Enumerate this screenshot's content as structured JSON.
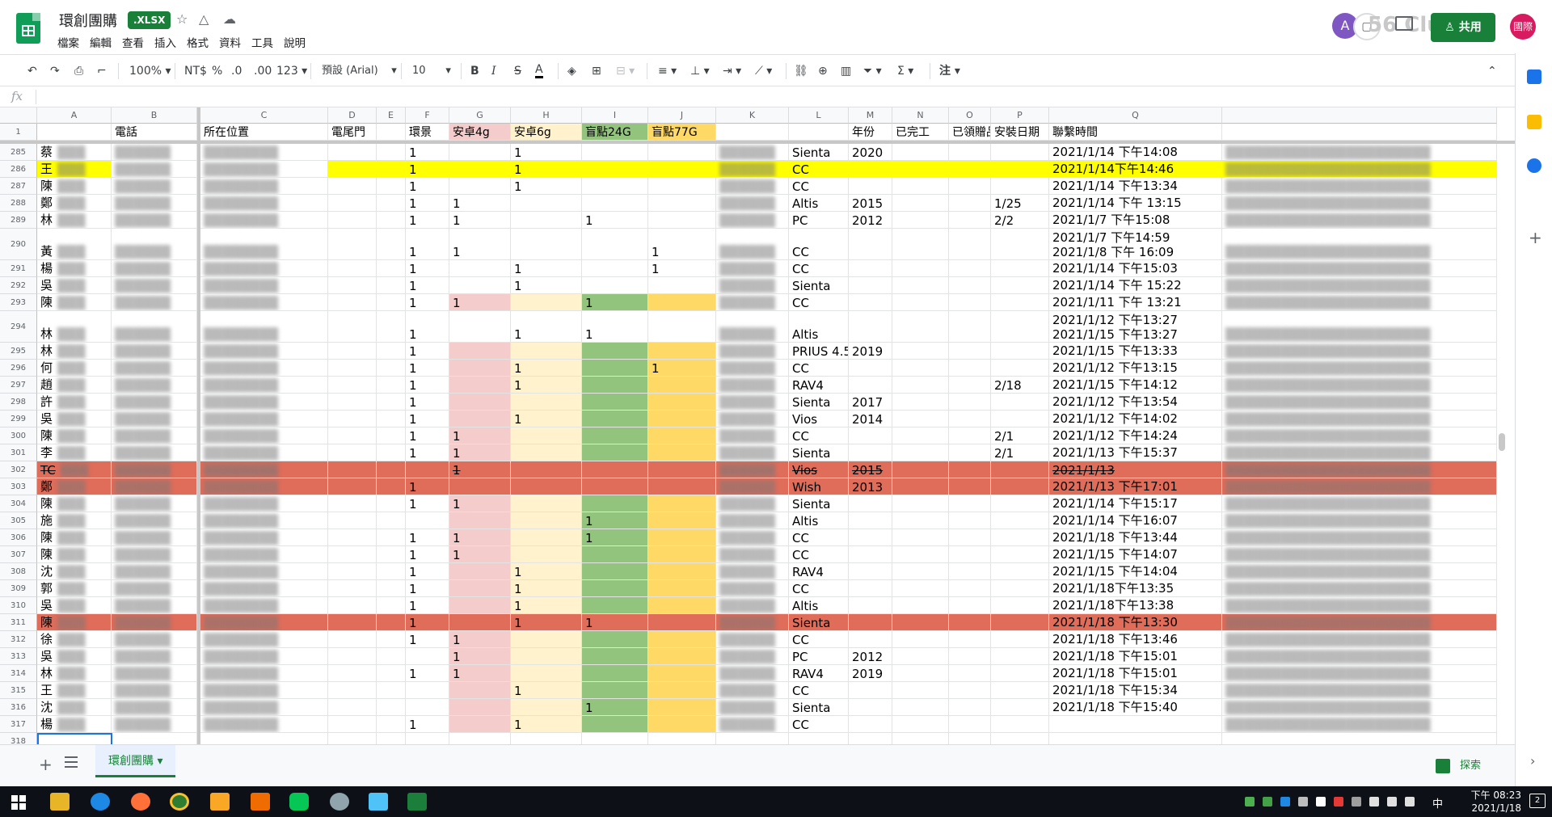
{
  "document": {
    "title": "環創團購",
    "badge": ".XLSX",
    "menu": [
      "檔案",
      "編輯",
      "查看",
      "插入",
      "格式",
      "資料",
      "工具",
      "說明"
    ],
    "share_label": "共用",
    "user_avatar_text": "國際",
    "collaborator_initial": "A",
    "watermark_text": "56 Clu"
  },
  "toolbar": {
    "zoom": "100%",
    "currency": "NT$",
    "percent": "%",
    "dec_decrease": ".0",
    "dec_increase": ".00",
    "format_more": "123",
    "font": "預設 (Arial)",
    "font_size": "10",
    "bold": "B",
    "italic": "I",
    "strike": "S",
    "text_color": "A",
    "sigma": "Σ",
    "note_btn": "注"
  },
  "formula_bar": {
    "fx": "fx"
  },
  "colors": {
    "yellow_row": "#ffff00",
    "red_row": "#e06c5a",
    "pink_col": "#f4cccc",
    "cream_col": "#fff2cc",
    "green_col": "#93c47d",
    "gold_col": "#ffd966",
    "brand_green": "#188038"
  },
  "grid": {
    "columns": [
      "A",
      "B",
      "C",
      "D",
      "E",
      "F",
      "G",
      "H",
      "I",
      "J",
      "K",
      "L",
      "M",
      "N",
      "O",
      "P",
      "Q"
    ],
    "header_row_number": "1",
    "header": [
      "",
      "電話",
      "所在位置",
      "電尾門",
      "",
      "環景",
      "安卓4g",
      "安卓6g",
      "盲點24G",
      "盲點77G",
      "",
      "",
      "年份",
      "已完工",
      "已領贈品",
      "安裝日期",
      "聯繫時間"
    ],
    "rows": [
      {
        "num": "285",
        "a": "蔡",
        "f": "1",
        "g": "",
        "h": "1",
        "i": "",
        "j": "",
        "l": "Sienta",
        "m": "2020",
        "p": "",
        "q": [
          "2021/1/14 下午14:08"
        ]
      },
      {
        "num": "286",
        "a": "王",
        "f": "1",
        "g": "",
        "h": "1",
        "i": "",
        "j": "",
        "l": "CC",
        "m": "",
        "p": "",
        "q": [
          "2021/1/14下午14:46"
        ]
      },
      {
        "num": "287",
        "a": "陳",
        "f": "1",
        "g": "",
        "h": "1",
        "i": "",
        "j": "",
        "l": "CC",
        "m": "",
        "p": "",
        "q": [
          "2021/1/14 下午13:34"
        ]
      },
      {
        "num": "288",
        "a": "鄭",
        "f": "1",
        "g": "1",
        "h": "",
        "i": "",
        "j": "",
        "l": "Altis",
        "m": "2015",
        "p": "1/25",
        "q": [
          "2021/1/14 下午 13:15"
        ]
      },
      {
        "num": "289",
        "a": "林",
        "f": "1",
        "g": "1",
        "h": "",
        "i": "1",
        "j": "",
        "l": "PC",
        "m": "2012",
        "p": "2/2",
        "q": [
          "2021/1/7 下午15:08"
        ]
      },
      {
        "num": "290",
        "a": "黃",
        "f": "1",
        "g": "1",
        "h": "",
        "i": "",
        "j": "1",
        "l": "CC",
        "m": "",
        "p": "",
        "q": [
          "2021/1/7 下午14:59",
          "2021/1/8 下午 16:09"
        ]
      },
      {
        "num": "291",
        "a": "楊",
        "f": "1",
        "g": "",
        "h": "1",
        "i": "",
        "j": "1",
        "l": "CC",
        "m": "",
        "p": "",
        "q": [
          "2021/1/14 下午15:03"
        ]
      },
      {
        "num": "292",
        "a": "吳",
        "f": "1",
        "g": "",
        "h": "1",
        "i": "",
        "j": "",
        "l": "Sienta",
        "m": "",
        "p": "",
        "q": [
          "2021/1/14 下午 15:22"
        ]
      },
      {
        "num": "293",
        "a": "陳",
        "f": "1",
        "g": "1",
        "h": "",
        "i": "1",
        "j": "",
        "l": "CC",
        "m": "",
        "p": "",
        "q": [
          "2021/1/11 下午 13:21"
        ]
      },
      {
        "num": "294",
        "a": "林",
        "f": "1",
        "g": "",
        "h": "1",
        "i": "1",
        "j": "",
        "l": "Altis",
        "m": "",
        "p": "",
        "q": [
          "2021/1/12 下午13:27",
          "2021/1/15 下午13:27"
        ]
      },
      {
        "num": "295",
        "a": "林",
        "f": "1",
        "g": "",
        "h": "",
        "i": "",
        "j": "",
        "l": "PRIUS 4.5",
        "m": "2019",
        "p": "",
        "q": [
          "2021/1/15 下午13:33"
        ]
      },
      {
        "num": "296",
        "a": "何",
        "f": "1",
        "g": "",
        "h": "1",
        "i": "",
        "j": "1",
        "l": "CC",
        "m": "",
        "p": "",
        "q": [
          "2021/1/12 下午13:15"
        ]
      },
      {
        "num": "297",
        "a": "趙",
        "f": "1",
        "g": "",
        "h": "1",
        "i": "",
        "j": "",
        "l": "RAV4",
        "m": "",
        "p": "2/18",
        "q": [
          "2021/1/15 下午14:12"
        ]
      },
      {
        "num": "298",
        "a": "許",
        "f": "1",
        "g": "",
        "h": "",
        "i": "",
        "j": "",
        "l": "Sienta",
        "m": "2017",
        "p": "",
        "q": [
          "2021/1/12 下午13:54"
        ]
      },
      {
        "num": "299",
        "a": "吳",
        "f": "1",
        "g": "",
        "h": "1",
        "i": "",
        "j": "",
        "l": "Vios",
        "m": "2014",
        "p": "",
        "q": [
          "2021/1/12 下午14:02"
        ]
      },
      {
        "num": "300",
        "a": "陳",
        "f": "1",
        "g": "1",
        "h": "",
        "i": "",
        "j": "",
        "l": "CC",
        "m": "",
        "p": "2/1",
        "q": [
          "2021/1/12 下午14:24"
        ]
      },
      {
        "num": "301",
        "a": "李",
        "f": "1",
        "g": "1",
        "h": "",
        "i": "",
        "j": "",
        "l": "Sienta",
        "m": "",
        "p": "2/1",
        "q": [
          "2021/1/13 下午15:37"
        ]
      },
      {
        "num": "302",
        "a": "TC",
        "f": "",
        "g": "1",
        "h": "",
        "i": "",
        "j": "",
        "l": "Vios",
        "m": "2015",
        "p": "",
        "q": [
          "2021/1/13"
        ]
      },
      {
        "num": "303",
        "a": "鄭",
        "f": "1",
        "g": "",
        "h": "",
        "i": "",
        "j": "",
        "l": "Wish",
        "m": "2013",
        "p": "",
        "q": [
          "2021/1/13 下午17:01"
        ]
      },
      {
        "num": "304",
        "a": "陳",
        "f": "1",
        "g": "1",
        "h": "",
        "i": "",
        "j": "",
        "l": "Sienta",
        "m": "",
        "p": "",
        "q": [
          "2021/1/14 下午15:17"
        ]
      },
      {
        "num": "305",
        "a": "施",
        "f": "",
        "g": "",
        "h": "",
        "i": "1",
        "j": "",
        "l": "Altis",
        "m": "",
        "p": "",
        "q": [
          "2021/1/14 下午16:07"
        ]
      },
      {
        "num": "306",
        "a": "陳",
        "f": "1",
        "g": "1",
        "h": "",
        "i": "1",
        "j": "",
        "l": "CC",
        "m": "",
        "p": "",
        "q": [
          "2021/1/18 下午13:44"
        ]
      },
      {
        "num": "307",
        "a": "陳",
        "f": "1",
        "g": "1",
        "h": "",
        "i": "",
        "j": "",
        "l": "CC",
        "m": "",
        "p": "",
        "q": [
          "2021/1/15 下午14:07"
        ]
      },
      {
        "num": "308",
        "a": "沈",
        "f": "1",
        "g": "",
        "h": "1",
        "i": "",
        "j": "",
        "l": "RAV4",
        "m": "",
        "p": "",
        "q": [
          "2021/1/15 下午14:04"
        ]
      },
      {
        "num": "309",
        "a": "郭",
        "f": "1",
        "g": "",
        "h": "1",
        "i": "",
        "j": "",
        "l": "CC",
        "m": "",
        "p": "",
        "q": [
          "2021/1/18下午13:35"
        ]
      },
      {
        "num": "310",
        "a": "吳",
        "f": "1",
        "g": "",
        "h": "1",
        "i": "",
        "j": "",
        "l": "Altis",
        "m": "",
        "p": "",
        "q": [
          "2021/1/18下午13:38"
        ]
      },
      {
        "num": "311",
        "a": "陳",
        "f": "1",
        "g": "",
        "h": "1",
        "i": "1",
        "j": "",
        "l": "Sienta",
        "m": "",
        "p": "",
        "q": [
          "2021/1/18 下午13:30"
        ]
      },
      {
        "num": "312",
        "a": "徐",
        "f": "1",
        "g": "1",
        "h": "",
        "i": "",
        "j": "",
        "l": "CC",
        "m": "",
        "p": "",
        "q": [
          "2021/1/18 下午13:46"
        ]
      },
      {
        "num": "313",
        "a": "吳",
        "f": "",
        "g": "1",
        "h": "",
        "i": "",
        "j": "",
        "l": "PC",
        "m": "2012",
        "p": "",
        "q": [
          "2021/1/18 下午15:01"
        ]
      },
      {
        "num": "314",
        "a": "林",
        "f": "1",
        "g": "1",
        "h": "",
        "i": "",
        "j": "",
        "l": "RAV4",
        "m": "2019",
        "p": "",
        "q": [
          "2021/1/18 下午15:01"
        ]
      },
      {
        "num": "315",
        "a": "王",
        "f": "",
        "g": "",
        "h": "1",
        "i": "",
        "j": "",
        "l": "CC",
        "m": "",
        "p": "",
        "q": [
          "2021/1/18 下午15:34"
        ]
      },
      {
        "num": "316",
        "a": "沈",
        "f": "",
        "g": "",
        "h": "",
        "i": "1",
        "j": "",
        "l": "Sienta",
        "m": "",
        "p": "",
        "q": [
          "2021/1/18 下午15:40"
        ]
      },
      {
        "num": "317",
        "a": "楊",
        "f": "1",
        "g": "",
        "h": "1",
        "i": "",
        "j": "",
        "l": "CC",
        "m": "",
        "p": "",
        "q": [
          ""
        ]
      },
      {
        "num": "318",
        "a": "",
        "f": "",
        "g": "",
        "h": "",
        "i": "",
        "j": "",
        "l": "",
        "m": "",
        "p": "",
        "q": [
          ""
        ]
      }
    ]
  },
  "sheet_bar": {
    "tab": "環創團購",
    "explore": "探索"
  },
  "taskbar": {
    "time": "下午 08:23",
    "date": "2021/1/18",
    "ime": "中",
    "notifications": "2"
  }
}
